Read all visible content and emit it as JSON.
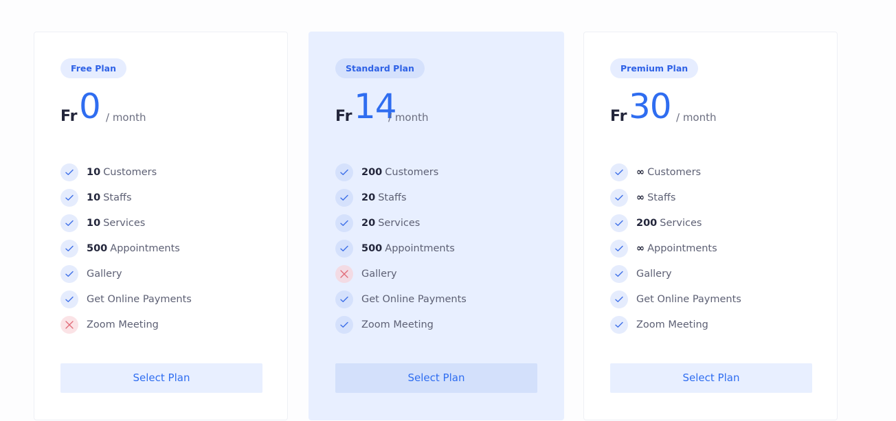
{
  "colors": {
    "accent": "#2F6DF0",
    "check": "#3D6FE8",
    "cross": "#E06A77",
    "highlight_card_bg": "#E8EFFF"
  },
  "plans": [
    {
      "badge": "Free Plan",
      "currency": "Fr",
      "amount": "0",
      "period": "/ month",
      "features": [
        {
          "icon": "check-icon",
          "qty": "10",
          "label": "Customers"
        },
        {
          "icon": "check-icon",
          "qty": "10",
          "label": "Staffs"
        },
        {
          "icon": "check-icon",
          "qty": "10",
          "label": "Services"
        },
        {
          "icon": "check-icon",
          "qty": "500",
          "label": "Appointments"
        },
        {
          "icon": "check-icon",
          "qty": "",
          "label": "Gallery"
        },
        {
          "icon": "check-icon",
          "qty": "",
          "label": "Get Online Payments"
        },
        {
          "icon": "close-icon",
          "qty": "",
          "label": "Zoom Meeting"
        }
      ],
      "button": "Select Plan"
    },
    {
      "badge": "Standard Plan",
      "currency": "Fr",
      "amount": "14",
      "period": "/ month",
      "features": [
        {
          "icon": "check-icon",
          "qty": "200",
          "label": "Customers"
        },
        {
          "icon": "check-icon",
          "qty": "20",
          "label": "Staffs"
        },
        {
          "icon": "check-icon",
          "qty": "20",
          "label": "Services"
        },
        {
          "icon": "check-icon",
          "qty": "500",
          "label": "Appointments"
        },
        {
          "icon": "close-icon",
          "qty": "",
          "label": "Gallery"
        },
        {
          "icon": "check-icon",
          "qty": "",
          "label": "Get Online Payments"
        },
        {
          "icon": "check-icon",
          "qty": "",
          "label": "Zoom Meeting"
        }
      ],
      "button": "Select Plan"
    },
    {
      "badge": "Premium Plan",
      "currency": "Fr",
      "amount": "30",
      "period": "/ month",
      "features": [
        {
          "icon": "check-icon",
          "qty": "∞",
          "label": "Customers"
        },
        {
          "icon": "check-icon",
          "qty": "∞",
          "label": "Staffs"
        },
        {
          "icon": "check-icon",
          "qty": "200",
          "label": "Services"
        },
        {
          "icon": "check-icon",
          "qty": "∞",
          "label": "Appointments"
        },
        {
          "icon": "check-icon",
          "qty": "",
          "label": "Gallery"
        },
        {
          "icon": "check-icon",
          "qty": "",
          "label": "Get Online Payments"
        },
        {
          "icon": "check-icon",
          "qty": "",
          "label": "Zoom Meeting"
        }
      ],
      "button": "Select Plan"
    }
  ]
}
